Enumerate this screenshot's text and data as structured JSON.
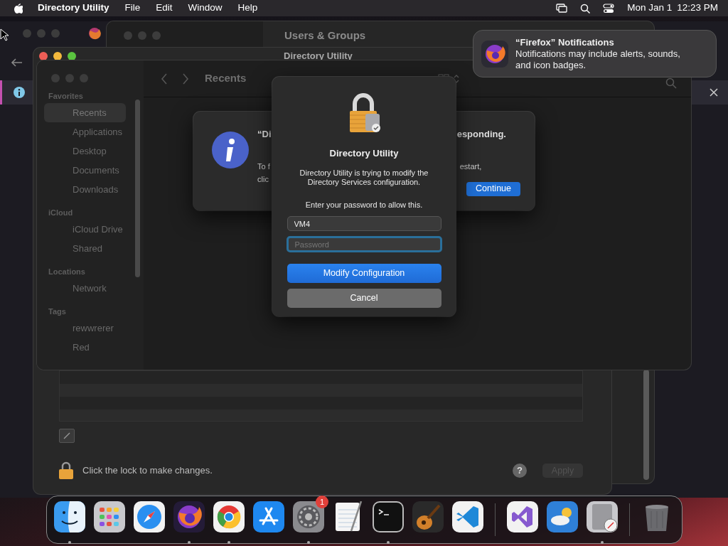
{
  "menu_bar": {
    "app_name": "Directory Utility",
    "menus": [
      "File",
      "Edit",
      "Window",
      "Help"
    ],
    "date": "Mon Jan 1",
    "time": "12:23 PM"
  },
  "notification": {
    "title": "“Firefox” Notifications",
    "body": "Notifications may include alerts, sounds, and icon badges."
  },
  "users_groups_window": {
    "title": "Users & Groups"
  },
  "directory_utility_window": {
    "title": "Directory Utility",
    "lock_text": "Click the lock to make changes.",
    "help": "?",
    "apply_button": {
      "label": "Apply",
      "disabled": true
    }
  },
  "finder_panel": {
    "location": "Recents",
    "sidebar": [
      {
        "heading": "Favorites",
        "items": [
          {
            "label": "Recents",
            "selected": true
          },
          {
            "label": "Applications",
            "selected": false
          },
          {
            "label": "Desktop",
            "selected": false
          },
          {
            "label": "Documents",
            "selected": false
          },
          {
            "label": "Downloads",
            "selected": false
          }
        ]
      },
      {
        "heading": "iCloud",
        "items": [
          {
            "label": "iCloud Drive",
            "selected": false
          },
          {
            "label": "Shared",
            "selected": false
          }
        ]
      },
      {
        "heading": "Locations",
        "items": [
          {
            "label": "Network",
            "selected": false
          }
        ]
      },
      {
        "heading": "Tags",
        "items": [
          {
            "label": "rewwrerer",
            "selected": false
          },
          {
            "label": "Red",
            "selected": false
          }
        ]
      }
    ]
  },
  "alert": {
    "title_fragments": [
      "“Di",
      "esponding."
    ],
    "body_fragments": [
      "To f",
      "estart,",
      "clic"
    ],
    "button": "Continue"
  },
  "auth_dialog": {
    "title": "Directory Utility",
    "message": "Directory Utility is trying to modify the Directory Services configuration.",
    "prompt": "Enter your password to allow this.",
    "username": "VM4",
    "password_placeholder": "Password",
    "buttons": [
      {
        "label": "Modify Configuration",
        "kind": "default"
      },
      {
        "label": "Cancel",
        "kind": "normal"
      }
    ]
  },
  "dock": {
    "apps": [
      {
        "kind": "finder",
        "running": true
      },
      {
        "kind": "launchpad",
        "running": false
      },
      {
        "kind": "safari",
        "running": false
      },
      {
        "kind": "firefox",
        "running": true
      },
      {
        "kind": "chrome",
        "running": true
      },
      {
        "kind": "appstore",
        "running": false
      },
      {
        "kind": "settings",
        "running": true,
        "badge": "1"
      },
      {
        "kind": "textedit",
        "running": false
      },
      {
        "kind": "terminal",
        "running": true
      },
      {
        "kind": "garageband",
        "running": false
      },
      {
        "kind": "vscode",
        "running": false
      },
      {
        "kind": "separator"
      },
      {
        "kind": "visualstudio",
        "running": false
      },
      {
        "kind": "weather",
        "running": false
      },
      {
        "kind": "directoryutility",
        "running": true
      },
      {
        "kind": "separator"
      },
      {
        "kind": "trash",
        "running": false
      }
    ]
  }
}
